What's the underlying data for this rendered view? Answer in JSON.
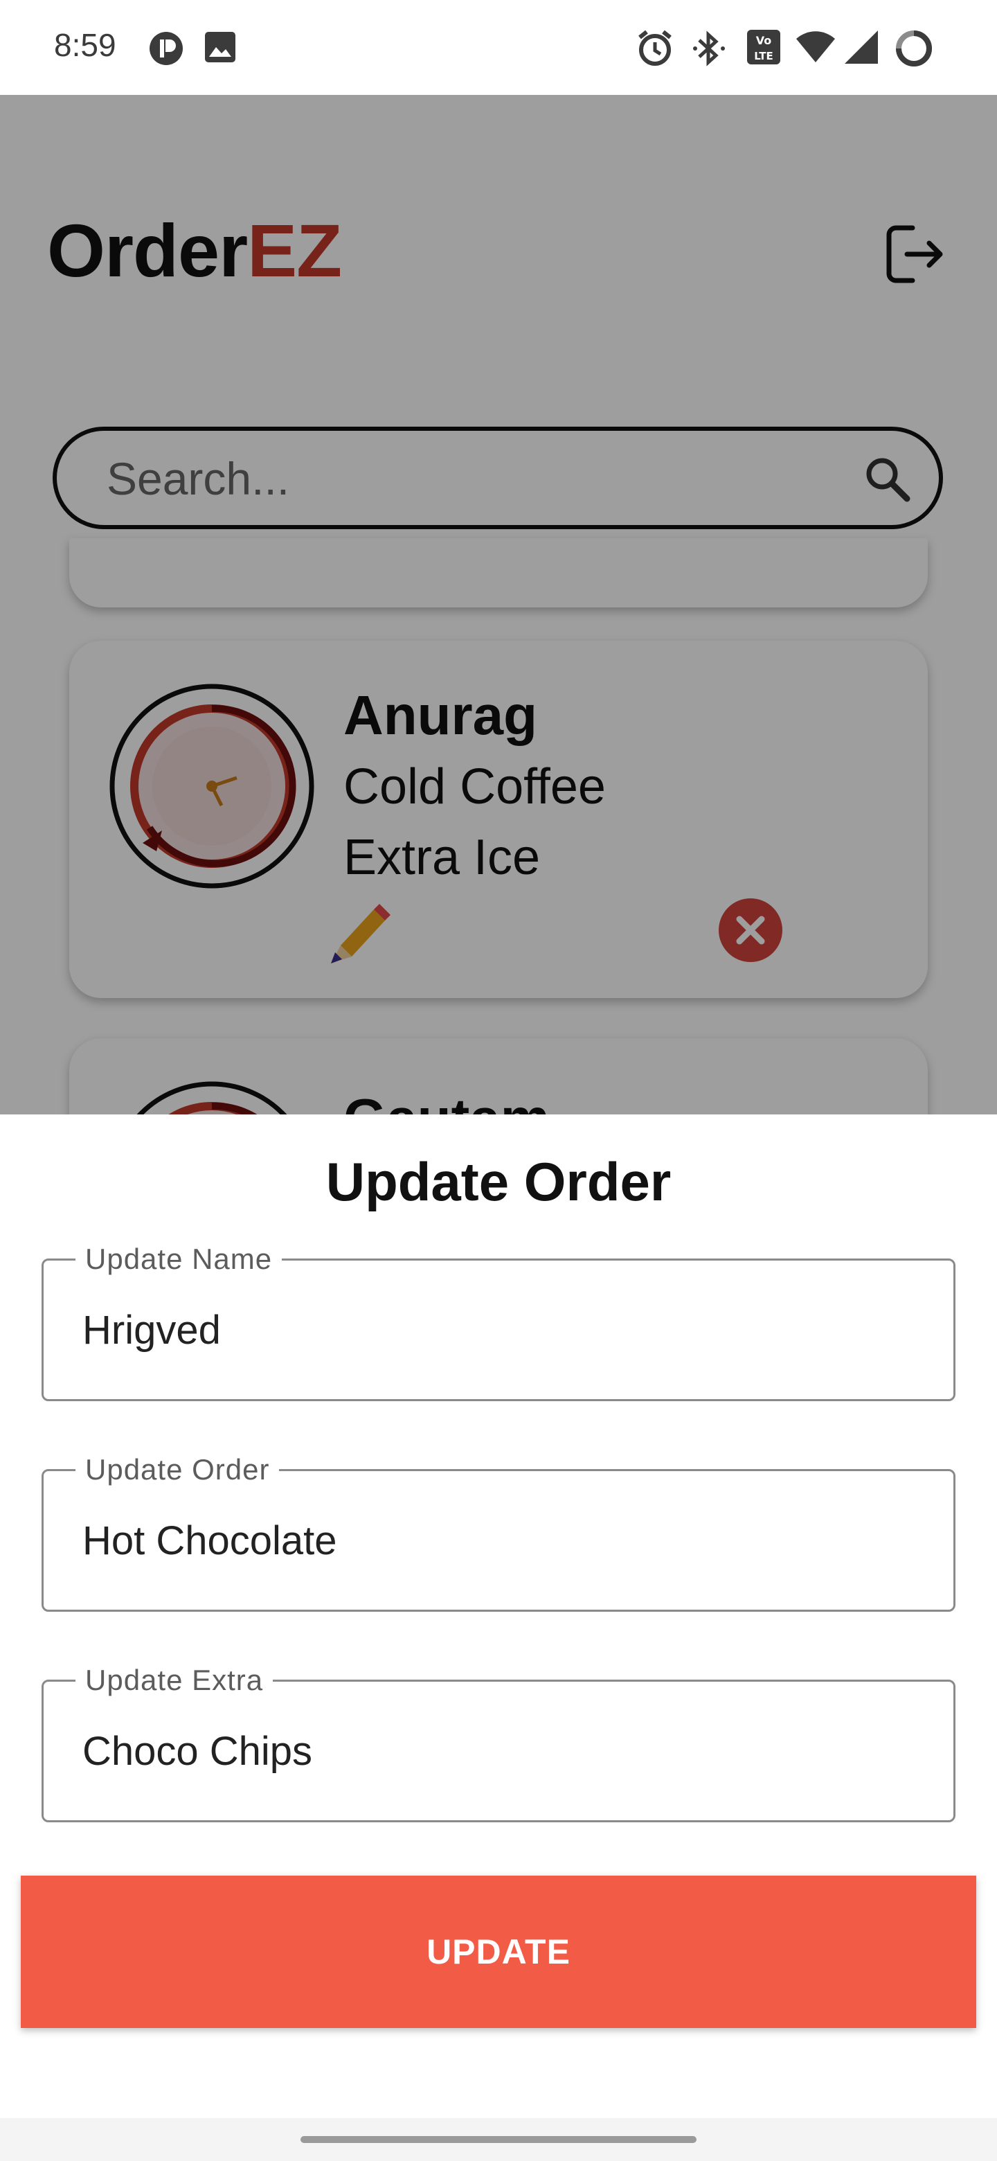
{
  "status_bar": {
    "time": "8:59",
    "left_icons": [
      "notification-p-icon",
      "image-icon"
    ],
    "right_icons": [
      "alarm-icon",
      "bluetooth-icon",
      "volte-icon",
      "wifi-icon",
      "signal-icon",
      "battery-ring-icon"
    ]
  },
  "app": {
    "logo_part1": "Order",
    "logo_part2": "EZ",
    "logout_icon": "logout-icon",
    "search": {
      "placeholder": "Search..."
    },
    "orders": [
      {
        "name": "Anurag",
        "order": "Cold Coffee",
        "extra": "Extra Ice"
      },
      {
        "name": "Gautam"
      }
    ]
  },
  "sheet": {
    "title": "Update Order",
    "fields": [
      {
        "label": "Update Name",
        "value": "Hrigved"
      },
      {
        "label": "Update Order",
        "value": "Hot Chocolate"
      },
      {
        "label": "Update Extra",
        "value": "Choco Chips"
      }
    ],
    "button_label": "UPDATE"
  },
  "colors": {
    "brand_accent": "#c0392b",
    "button": "#f25c47",
    "delete": "#d0453c",
    "scrim": "rgba(0,0,0,0.38)"
  }
}
